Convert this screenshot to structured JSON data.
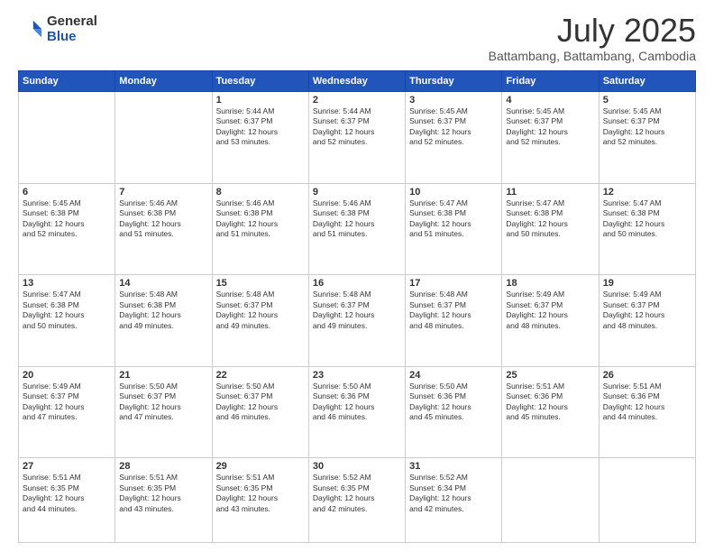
{
  "logo": {
    "general": "General",
    "blue": "Blue"
  },
  "header": {
    "month": "July 2025",
    "location": "Battambang, Battambang, Cambodia"
  },
  "weekdays": [
    "Sunday",
    "Monday",
    "Tuesday",
    "Wednesday",
    "Thursday",
    "Friday",
    "Saturday"
  ],
  "weeks": [
    [
      {
        "day": "",
        "info": ""
      },
      {
        "day": "",
        "info": ""
      },
      {
        "day": "1",
        "info": "Sunrise: 5:44 AM\nSunset: 6:37 PM\nDaylight: 12 hours\nand 53 minutes."
      },
      {
        "day": "2",
        "info": "Sunrise: 5:44 AM\nSunset: 6:37 PM\nDaylight: 12 hours\nand 52 minutes."
      },
      {
        "day": "3",
        "info": "Sunrise: 5:45 AM\nSunset: 6:37 PM\nDaylight: 12 hours\nand 52 minutes."
      },
      {
        "day": "4",
        "info": "Sunrise: 5:45 AM\nSunset: 6:37 PM\nDaylight: 12 hours\nand 52 minutes."
      },
      {
        "day": "5",
        "info": "Sunrise: 5:45 AM\nSunset: 6:37 PM\nDaylight: 12 hours\nand 52 minutes."
      }
    ],
    [
      {
        "day": "6",
        "info": "Sunrise: 5:45 AM\nSunset: 6:38 PM\nDaylight: 12 hours\nand 52 minutes."
      },
      {
        "day": "7",
        "info": "Sunrise: 5:46 AM\nSunset: 6:38 PM\nDaylight: 12 hours\nand 51 minutes."
      },
      {
        "day": "8",
        "info": "Sunrise: 5:46 AM\nSunset: 6:38 PM\nDaylight: 12 hours\nand 51 minutes."
      },
      {
        "day": "9",
        "info": "Sunrise: 5:46 AM\nSunset: 6:38 PM\nDaylight: 12 hours\nand 51 minutes."
      },
      {
        "day": "10",
        "info": "Sunrise: 5:47 AM\nSunset: 6:38 PM\nDaylight: 12 hours\nand 51 minutes."
      },
      {
        "day": "11",
        "info": "Sunrise: 5:47 AM\nSunset: 6:38 PM\nDaylight: 12 hours\nand 50 minutes."
      },
      {
        "day": "12",
        "info": "Sunrise: 5:47 AM\nSunset: 6:38 PM\nDaylight: 12 hours\nand 50 minutes."
      }
    ],
    [
      {
        "day": "13",
        "info": "Sunrise: 5:47 AM\nSunset: 6:38 PM\nDaylight: 12 hours\nand 50 minutes."
      },
      {
        "day": "14",
        "info": "Sunrise: 5:48 AM\nSunset: 6:38 PM\nDaylight: 12 hours\nand 49 minutes."
      },
      {
        "day": "15",
        "info": "Sunrise: 5:48 AM\nSunset: 6:37 PM\nDaylight: 12 hours\nand 49 minutes."
      },
      {
        "day": "16",
        "info": "Sunrise: 5:48 AM\nSunset: 6:37 PM\nDaylight: 12 hours\nand 49 minutes."
      },
      {
        "day": "17",
        "info": "Sunrise: 5:48 AM\nSunset: 6:37 PM\nDaylight: 12 hours\nand 48 minutes."
      },
      {
        "day": "18",
        "info": "Sunrise: 5:49 AM\nSunset: 6:37 PM\nDaylight: 12 hours\nand 48 minutes."
      },
      {
        "day": "19",
        "info": "Sunrise: 5:49 AM\nSunset: 6:37 PM\nDaylight: 12 hours\nand 48 minutes."
      }
    ],
    [
      {
        "day": "20",
        "info": "Sunrise: 5:49 AM\nSunset: 6:37 PM\nDaylight: 12 hours\nand 47 minutes."
      },
      {
        "day": "21",
        "info": "Sunrise: 5:50 AM\nSunset: 6:37 PM\nDaylight: 12 hours\nand 47 minutes."
      },
      {
        "day": "22",
        "info": "Sunrise: 5:50 AM\nSunset: 6:37 PM\nDaylight: 12 hours\nand 46 minutes."
      },
      {
        "day": "23",
        "info": "Sunrise: 5:50 AM\nSunset: 6:36 PM\nDaylight: 12 hours\nand 46 minutes."
      },
      {
        "day": "24",
        "info": "Sunrise: 5:50 AM\nSunset: 6:36 PM\nDaylight: 12 hours\nand 45 minutes."
      },
      {
        "day": "25",
        "info": "Sunrise: 5:51 AM\nSunset: 6:36 PM\nDaylight: 12 hours\nand 45 minutes."
      },
      {
        "day": "26",
        "info": "Sunrise: 5:51 AM\nSunset: 6:36 PM\nDaylight: 12 hours\nand 44 minutes."
      }
    ],
    [
      {
        "day": "27",
        "info": "Sunrise: 5:51 AM\nSunset: 6:35 PM\nDaylight: 12 hours\nand 44 minutes."
      },
      {
        "day": "28",
        "info": "Sunrise: 5:51 AM\nSunset: 6:35 PM\nDaylight: 12 hours\nand 43 minutes."
      },
      {
        "day": "29",
        "info": "Sunrise: 5:51 AM\nSunset: 6:35 PM\nDaylight: 12 hours\nand 43 minutes."
      },
      {
        "day": "30",
        "info": "Sunrise: 5:52 AM\nSunset: 6:35 PM\nDaylight: 12 hours\nand 42 minutes."
      },
      {
        "day": "31",
        "info": "Sunrise: 5:52 AM\nSunset: 6:34 PM\nDaylight: 12 hours\nand 42 minutes."
      },
      {
        "day": "",
        "info": ""
      },
      {
        "day": "",
        "info": ""
      }
    ]
  ]
}
